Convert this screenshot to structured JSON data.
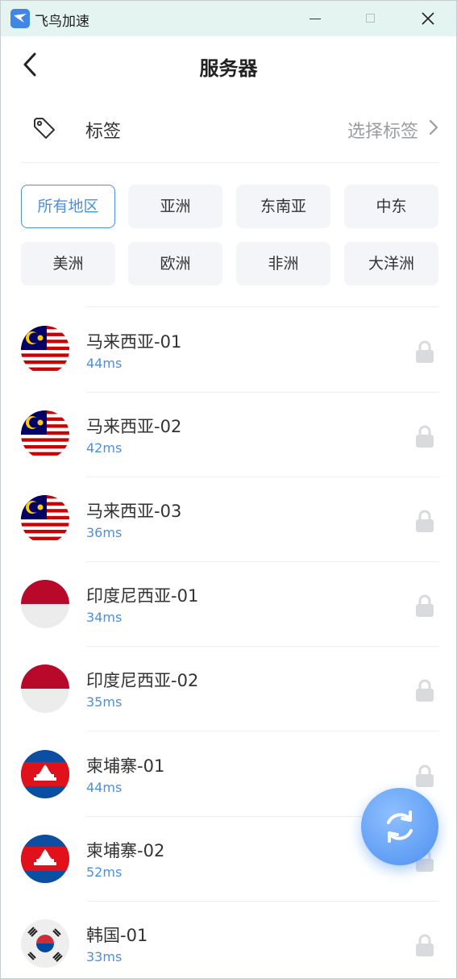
{
  "window": {
    "title": "飞鸟加速"
  },
  "header": {
    "title": "服务器"
  },
  "tag": {
    "label": "标签",
    "select": "选择标签"
  },
  "regions": [
    {
      "label": "所有地区",
      "active": true
    },
    {
      "label": "亚洲"
    },
    {
      "label": "东南亚"
    },
    {
      "label": "中东"
    },
    {
      "label": "美洲"
    },
    {
      "label": "欧洲"
    },
    {
      "label": "非洲"
    },
    {
      "label": "大洋洲"
    }
  ],
  "servers": [
    {
      "name": "马来西亚-01",
      "ping": "44ms",
      "flag": "malaysia-flag-icon",
      "locked": true
    },
    {
      "name": "马来西亚-02",
      "ping": "42ms",
      "flag": "malaysia-flag-icon",
      "locked": true
    },
    {
      "name": "马来西亚-03",
      "ping": "36ms",
      "flag": "malaysia-flag-icon",
      "locked": true
    },
    {
      "name": "印度尼西亚-01",
      "ping": "34ms",
      "flag": "indonesia-flag-icon",
      "locked": true
    },
    {
      "name": "印度尼西亚-02",
      "ping": "35ms",
      "flag": "indonesia-flag-icon",
      "locked": true
    },
    {
      "name": "柬埔寨-01",
      "ping": "44ms",
      "flag": "cambodia-flag-icon",
      "locked": true
    },
    {
      "name": "柬埔寨-02",
      "ping": "52ms",
      "flag": "cambodia-flag-icon",
      "locked": true
    },
    {
      "name": "韩国-01",
      "ping": "33ms",
      "flag": "korea-flag-icon",
      "locked": true
    }
  ],
  "colors": {
    "accent": "#4a8fe0",
    "titlebar": "#e3f4f1",
    "chip_bg": "#f4f5f8",
    "lock": "#d8dadd"
  },
  "icons": {
    "back": "chevron-left-icon",
    "tag": "tag-icon",
    "refresh": "refresh-icon",
    "lock": "lock-icon"
  }
}
